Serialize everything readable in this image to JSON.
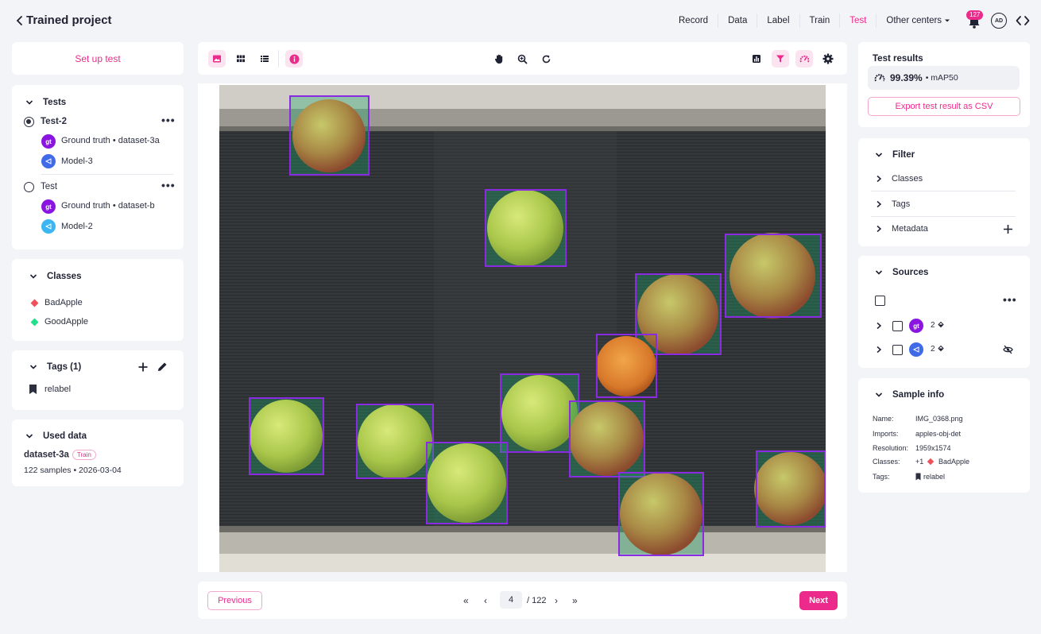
{
  "header": {
    "title": "Trained project",
    "nav": [
      "Record",
      "Data",
      "Label",
      "Train",
      "Test",
      "Other centers"
    ],
    "active_nav": "Test",
    "notification_count": "127",
    "avatar_initials": "AD"
  },
  "left": {
    "setup_label": "Set up test",
    "tests_title": "Tests",
    "tests": [
      {
        "name": "Test-2",
        "selected": true,
        "gt": "Ground truth • dataset-3a",
        "model": "Model-3"
      },
      {
        "name": "Test",
        "selected": false,
        "gt": "Ground truth • dataset-b",
        "model": "Model-2"
      }
    ],
    "gt_badge": "gt",
    "classes_title": "Classes",
    "classes": [
      {
        "name": "BadApple",
        "color": "#f0505a"
      },
      {
        "name": "GoodApple",
        "color": "#1ee08a"
      }
    ],
    "tags_title": "Tags (1)",
    "tags": [
      "relabel"
    ],
    "used_title": "Used data",
    "dataset_name": "dataset-3a",
    "dataset_tag": "Train",
    "dataset_meta": "122 samples • 2026-03-04"
  },
  "pager": {
    "previous": "Previous",
    "next": "Next",
    "page": "4",
    "total": "/ 122"
  },
  "right": {
    "results_title": "Test results",
    "score": "99.39%",
    "metric": "• mAP50",
    "export_label": "Export test result as CSV",
    "filter_title": "Filter",
    "filter_items": [
      "Classes",
      "Tags",
      "Metadata"
    ],
    "sources_title": "Sources",
    "sources": [
      {
        "kind": "gt",
        "count": "2"
      },
      {
        "kind": "model",
        "count": "2"
      }
    ],
    "sample_title": "Sample info",
    "sample": {
      "name_label": "Name:",
      "name": "IMG_0368.png",
      "imports_label": "Imports:",
      "imports": "apples-obj-det",
      "resolution_label": "Resolution:",
      "resolution": "1959x1574",
      "classes_label": "Classes:",
      "classes_extra": "+1",
      "classes_name": "BadApple",
      "tags_label": "Tags:",
      "tags": "relabel"
    }
  },
  "colors": {
    "accent": "#ec2a8b",
    "box": "#8a2be2",
    "gt": "#8a15e0",
    "model": "#3f6ae8"
  }
}
